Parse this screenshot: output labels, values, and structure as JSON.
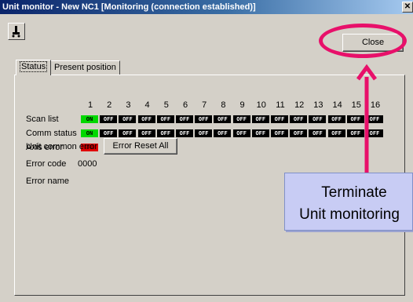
{
  "window": {
    "title": "Unit monitor - New NC1 [Monitoring (connection established)]",
    "close_glyph": "✕"
  },
  "toolbar": {
    "icon": "monitor-tool-icon"
  },
  "buttons": {
    "close": "Close",
    "error_reset_all": "Error Reset All"
  },
  "tabs": [
    {
      "label": "Status",
      "active": true
    },
    {
      "label": "Present position",
      "active": false
    }
  ],
  "grid": {
    "columns": [
      "1",
      "2",
      "3",
      "4",
      "5",
      "6",
      "7",
      "8",
      "9",
      "10",
      "11",
      "12",
      "13",
      "14",
      "15",
      "16"
    ],
    "rows": [
      {
        "label": "Scan list",
        "values": [
          "ON",
          "OFF",
          "OFF",
          "OFF",
          "OFF",
          "OFF",
          "OFF",
          "OFF",
          "OFF",
          "OFF",
          "OFF",
          "OFF",
          "OFF",
          "OFF",
          "OFF",
          "OFF"
        ]
      },
      {
        "label": "Comm status",
        "values": [
          "ON",
          "OFF",
          "OFF",
          "OFF",
          "OFF",
          "OFF",
          "OFF",
          "OFF",
          "OFF",
          "OFF",
          "OFF",
          "OFF",
          "OFF",
          "OFF",
          "OFF",
          "OFF"
        ]
      },
      {
        "label": "Axis error",
        "values": [
          "ERR"
        ]
      }
    ]
  },
  "unit_common_error": {
    "label": "Unit common error"
  },
  "error_code": {
    "label": "Error code",
    "value": "0000"
  },
  "error_name": {
    "label": "Error name",
    "value": ""
  },
  "annotation": {
    "line1": "Terminate",
    "line2": "Unit monitoring",
    "ring_color": "#e8106a",
    "callout_color": "#c8ccf4"
  },
  "colors": {
    "on": "#00d800",
    "off": "#000000",
    "err": "#e00000"
  }
}
